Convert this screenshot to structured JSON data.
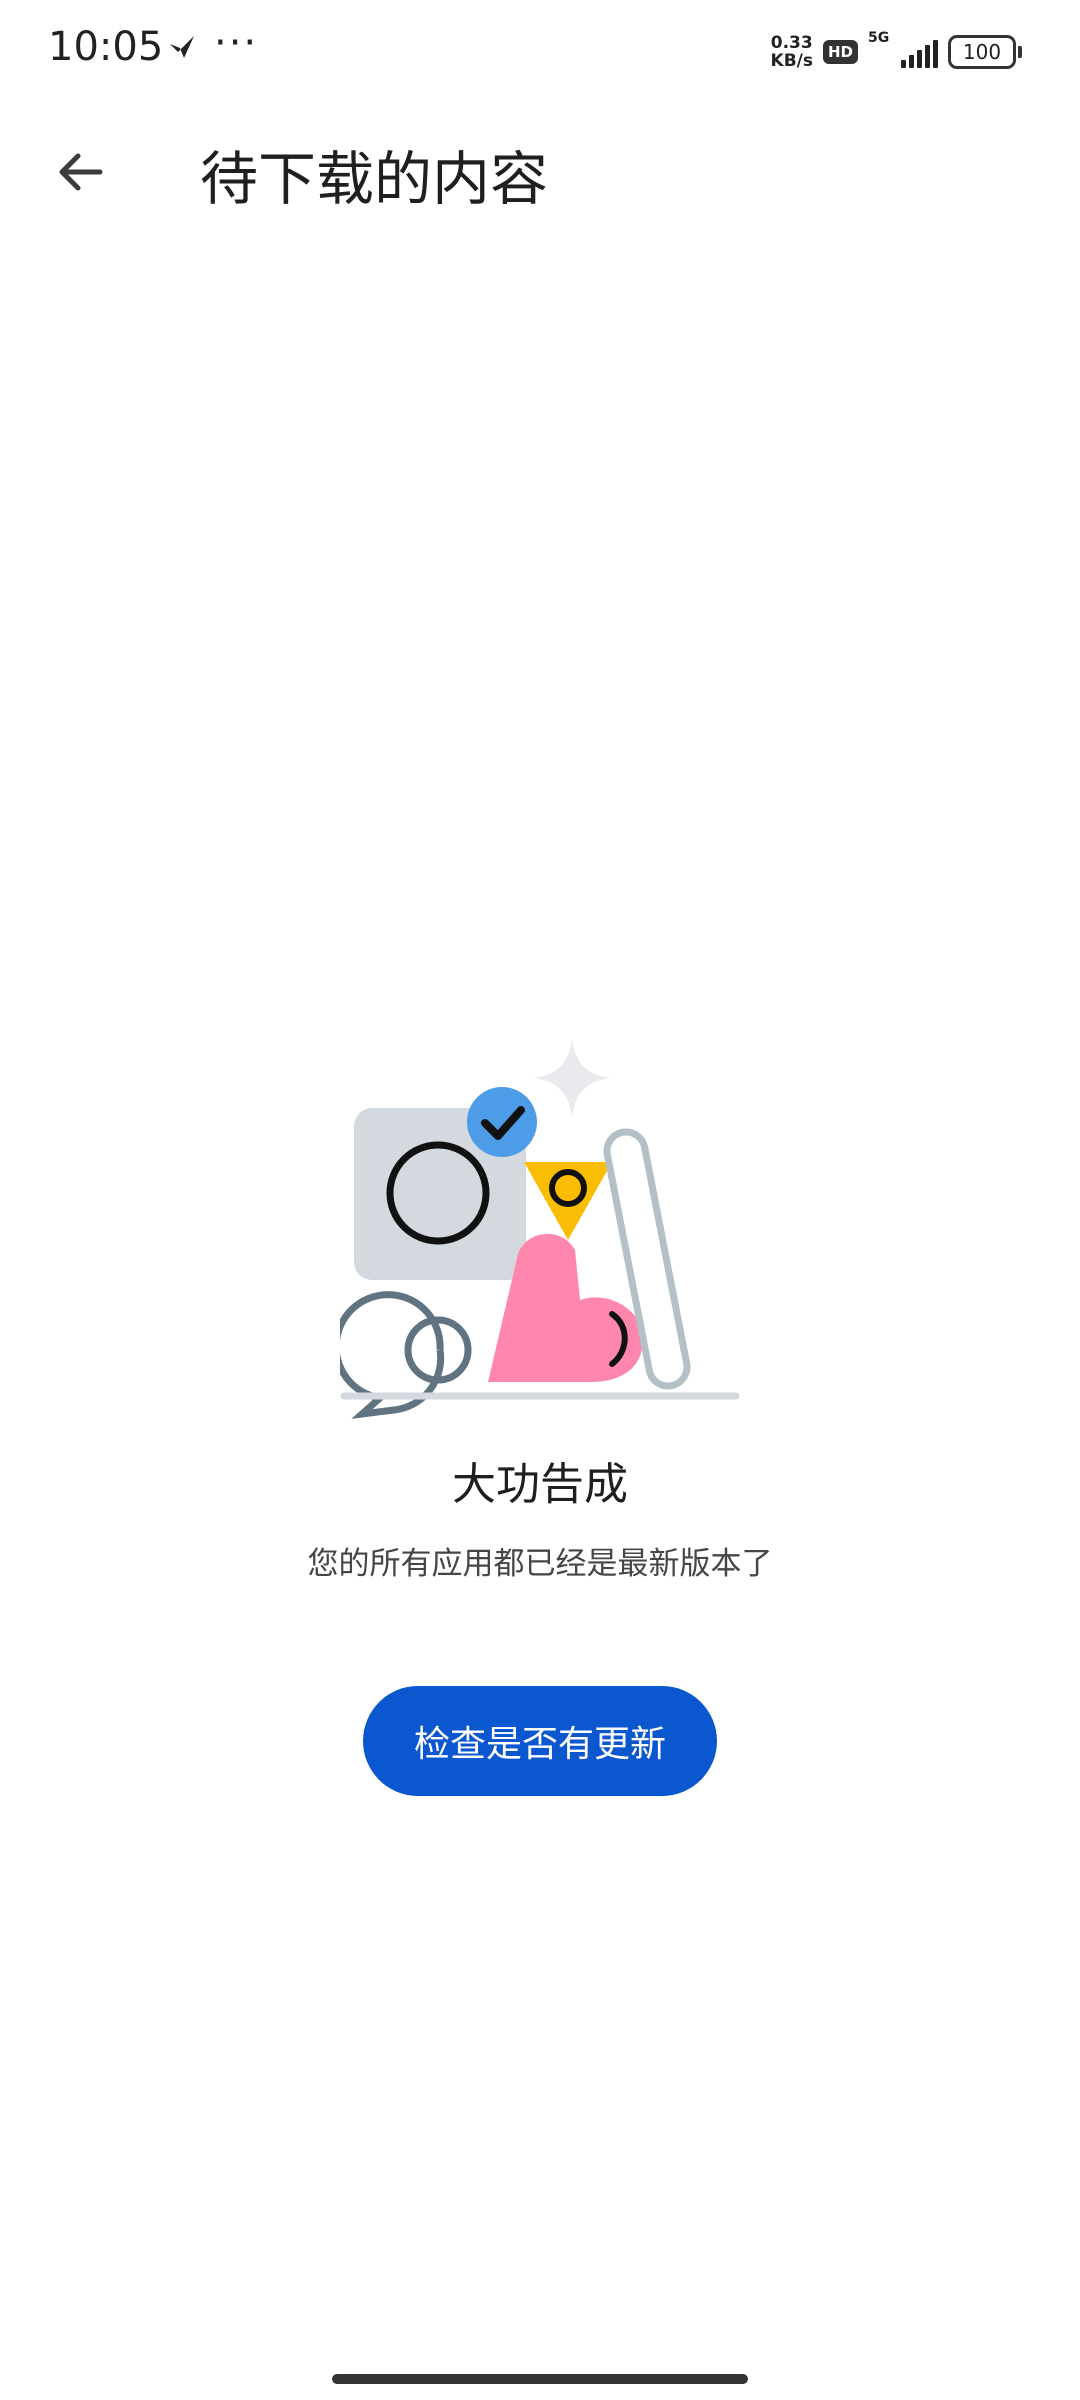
{
  "status_bar": {
    "time": "10:05",
    "more": "···",
    "net_speed_value": "0.33",
    "net_speed_unit": "KB/s",
    "hd": "HD",
    "network": "5G",
    "battery": "100"
  },
  "app_bar": {
    "back_icon": "arrow-back-icon",
    "title": "待下载的内容"
  },
  "empty_state": {
    "title": "大功告成",
    "subtitle": "您的所有应用都已经是最新版本了",
    "button_label": "检查是否有更新"
  },
  "colors": {
    "primary": "#0b57d0",
    "check_badge": "#4c9ce8",
    "heart": "#ff86ad",
    "triangle": "#fbbc04",
    "tile": "#d3d9de",
    "bubble": "#5f7480"
  }
}
